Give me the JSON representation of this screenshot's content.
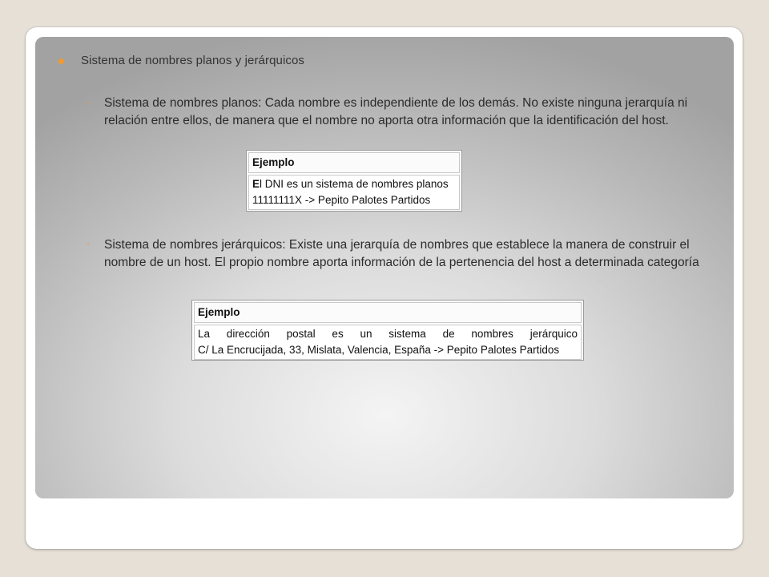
{
  "slide": {
    "heading": "Sistema de nombres planos y jerárquicos",
    "sub_bullet_glyph": "◦",
    "items": [
      {
        "text": "Sistema de nombres planos: Cada nombre es independiente de los demás. No existe ninguna jerarquía ni relación entre ellos, de manera que el nombre no aporta otra información que la identificación del host.",
        "example": {
          "title": "Ejemplo",
          "line1_first": "E",
          "line1_rest": "l DNI es un sistema de nombres planos",
          "line2": "11111111X -> Pepito Palotes Partidos"
        }
      },
      {
        "text": "Sistema de nombres jerárquicos: Existe una jerarquía de nombres que establece la manera de construir el nombre de un host. El propio nombre aporta información de la pertenencia del host a determinada categoría",
        "example": {
          "title": "Ejemplo",
          "line1": "La dirección postal es un sistema de nombres jerárquico",
          "line2": "C/ La Encrucijada, 33, Mislata, Valencia, España -> Pepito Palotes Partidos"
        }
      }
    ]
  },
  "colors": {
    "bullet": "#f29a2e",
    "background": "#e6e0d6"
  }
}
